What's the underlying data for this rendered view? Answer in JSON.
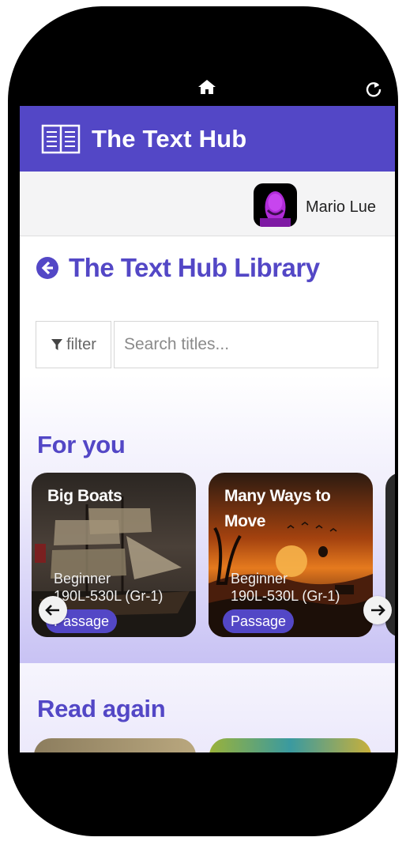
{
  "app": {
    "title": "The Text Hub"
  },
  "user": {
    "name": "Mario Lue"
  },
  "library": {
    "title": "The Text Hub Library"
  },
  "search": {
    "filter_label": "filter",
    "placeholder": "Search titles..."
  },
  "sections": {
    "for_you": {
      "title": "For you",
      "cards": [
        {
          "title": "Big Boats",
          "level": "Beginner",
          "range": "190L-530L (Gr-1)",
          "type": "Passage"
        },
        {
          "title": "Many Ways to Move",
          "level": "Beginner",
          "range": "190L-530L (Gr-1)",
          "type": "Passage"
        }
      ]
    },
    "read_again": {
      "title": "Read again"
    }
  },
  "colors": {
    "brand": "#5347c6",
    "user_bar": "#f4f4f5"
  },
  "icons": {
    "status_home": "home-icon",
    "status_reload": "reload-icon",
    "logo": "book-icon",
    "back": "back-arrow-icon",
    "filter": "filter-icon",
    "prev": "arrow-left-icon",
    "next": "arrow-right-icon"
  }
}
